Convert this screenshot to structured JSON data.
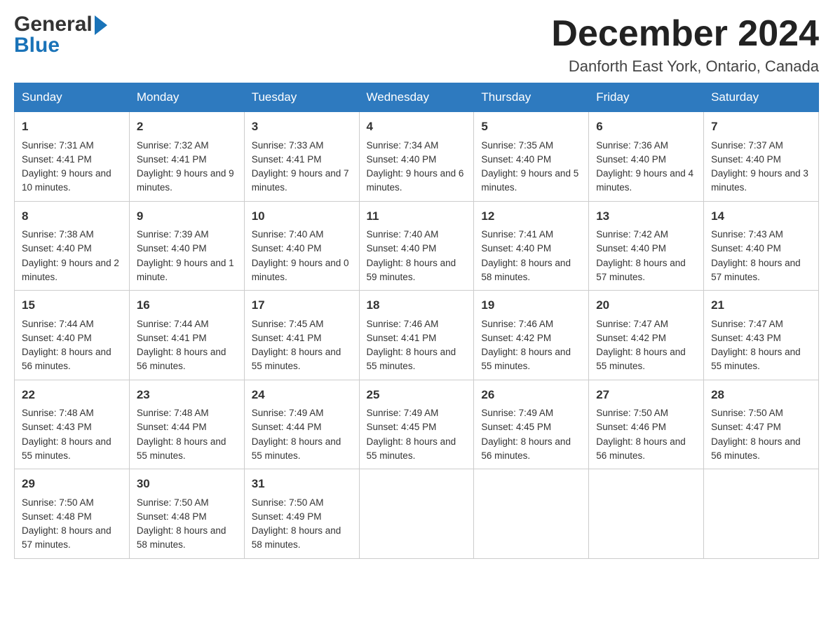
{
  "header": {
    "logo_line1": "General",
    "logo_line2": "Blue",
    "month_title": "December 2024",
    "location": "Danforth East York, Ontario, Canada"
  },
  "calendar": {
    "days_of_week": [
      "Sunday",
      "Monday",
      "Tuesday",
      "Wednesday",
      "Thursday",
      "Friday",
      "Saturday"
    ],
    "weeks": [
      [
        {
          "day": "1",
          "sunrise": "7:31 AM",
          "sunset": "4:41 PM",
          "daylight": "9 hours and 10 minutes."
        },
        {
          "day": "2",
          "sunrise": "7:32 AM",
          "sunset": "4:41 PM",
          "daylight": "9 hours and 9 minutes."
        },
        {
          "day": "3",
          "sunrise": "7:33 AM",
          "sunset": "4:41 PM",
          "daylight": "9 hours and 7 minutes."
        },
        {
          "day": "4",
          "sunrise": "7:34 AM",
          "sunset": "4:40 PM",
          "daylight": "9 hours and 6 minutes."
        },
        {
          "day": "5",
          "sunrise": "7:35 AM",
          "sunset": "4:40 PM",
          "daylight": "9 hours and 5 minutes."
        },
        {
          "day": "6",
          "sunrise": "7:36 AM",
          "sunset": "4:40 PM",
          "daylight": "9 hours and 4 minutes."
        },
        {
          "day": "7",
          "sunrise": "7:37 AM",
          "sunset": "4:40 PM",
          "daylight": "9 hours and 3 minutes."
        }
      ],
      [
        {
          "day": "8",
          "sunrise": "7:38 AM",
          "sunset": "4:40 PM",
          "daylight": "9 hours and 2 minutes."
        },
        {
          "day": "9",
          "sunrise": "7:39 AM",
          "sunset": "4:40 PM",
          "daylight": "9 hours and 1 minute."
        },
        {
          "day": "10",
          "sunrise": "7:40 AM",
          "sunset": "4:40 PM",
          "daylight": "9 hours and 0 minutes."
        },
        {
          "day": "11",
          "sunrise": "7:40 AM",
          "sunset": "4:40 PM",
          "daylight": "8 hours and 59 minutes."
        },
        {
          "day": "12",
          "sunrise": "7:41 AM",
          "sunset": "4:40 PM",
          "daylight": "8 hours and 58 minutes."
        },
        {
          "day": "13",
          "sunrise": "7:42 AM",
          "sunset": "4:40 PM",
          "daylight": "8 hours and 57 minutes."
        },
        {
          "day": "14",
          "sunrise": "7:43 AM",
          "sunset": "4:40 PM",
          "daylight": "8 hours and 57 minutes."
        }
      ],
      [
        {
          "day": "15",
          "sunrise": "7:44 AM",
          "sunset": "4:40 PM",
          "daylight": "8 hours and 56 minutes."
        },
        {
          "day": "16",
          "sunrise": "7:44 AM",
          "sunset": "4:41 PM",
          "daylight": "8 hours and 56 minutes."
        },
        {
          "day": "17",
          "sunrise": "7:45 AM",
          "sunset": "4:41 PM",
          "daylight": "8 hours and 55 minutes."
        },
        {
          "day": "18",
          "sunrise": "7:46 AM",
          "sunset": "4:41 PM",
          "daylight": "8 hours and 55 minutes."
        },
        {
          "day": "19",
          "sunrise": "7:46 AM",
          "sunset": "4:42 PM",
          "daylight": "8 hours and 55 minutes."
        },
        {
          "day": "20",
          "sunrise": "7:47 AM",
          "sunset": "4:42 PM",
          "daylight": "8 hours and 55 minutes."
        },
        {
          "day": "21",
          "sunrise": "7:47 AM",
          "sunset": "4:43 PM",
          "daylight": "8 hours and 55 minutes."
        }
      ],
      [
        {
          "day": "22",
          "sunrise": "7:48 AM",
          "sunset": "4:43 PM",
          "daylight": "8 hours and 55 minutes."
        },
        {
          "day": "23",
          "sunrise": "7:48 AM",
          "sunset": "4:44 PM",
          "daylight": "8 hours and 55 minutes."
        },
        {
          "day": "24",
          "sunrise": "7:49 AM",
          "sunset": "4:44 PM",
          "daylight": "8 hours and 55 minutes."
        },
        {
          "day": "25",
          "sunrise": "7:49 AM",
          "sunset": "4:45 PM",
          "daylight": "8 hours and 55 minutes."
        },
        {
          "day": "26",
          "sunrise": "7:49 AM",
          "sunset": "4:45 PM",
          "daylight": "8 hours and 56 minutes."
        },
        {
          "day": "27",
          "sunrise": "7:50 AM",
          "sunset": "4:46 PM",
          "daylight": "8 hours and 56 minutes."
        },
        {
          "day": "28",
          "sunrise": "7:50 AM",
          "sunset": "4:47 PM",
          "daylight": "8 hours and 56 minutes."
        }
      ],
      [
        {
          "day": "29",
          "sunrise": "7:50 AM",
          "sunset": "4:48 PM",
          "daylight": "8 hours and 57 minutes."
        },
        {
          "day": "30",
          "sunrise": "7:50 AM",
          "sunset": "4:48 PM",
          "daylight": "8 hours and 58 minutes."
        },
        {
          "day": "31",
          "sunrise": "7:50 AM",
          "sunset": "4:49 PM",
          "daylight": "8 hours and 58 minutes."
        },
        null,
        null,
        null,
        null
      ]
    ]
  },
  "labels": {
    "sunrise": "Sunrise:",
    "sunset": "Sunset:",
    "daylight": "Daylight:"
  }
}
